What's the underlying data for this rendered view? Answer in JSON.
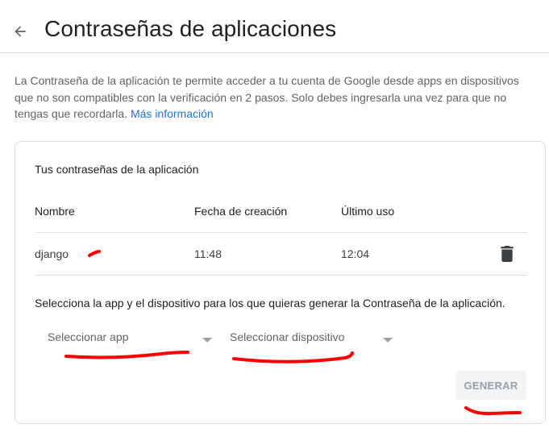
{
  "header": {
    "back_icon": "arrow-back-icon",
    "title": "Contraseñas de aplicaciones"
  },
  "intro": {
    "text": "La Contraseña de la aplicación te permite acceder a tu cuenta de Google desde apps en dispositivos que no son compatibles con la verificación en 2 pasos. Solo debes ingresarla una vez para que no tengas que recordarla. ",
    "link": "Más información",
    "link_color": "#1a73e8"
  },
  "card": {
    "title": "Tus contraseñas de la aplicación",
    "columns": [
      "Nombre",
      "Fecha de creación",
      "Último uso"
    ],
    "rows": [
      {
        "name": "django",
        "created": "11:48",
        "last_used": "12:04",
        "action_icon": "trash-icon"
      }
    ],
    "instruction": "Selecciona la app y el dispositivo para los que quieras generar la Contraseña de la aplicación.",
    "app_select": {
      "placeholder": "Seleccionar app"
    },
    "device_select": {
      "placeholder": "Seleccionar dispositivo"
    },
    "generate_label": "GENERAR"
  },
  "annotation_color": "#ff0000"
}
